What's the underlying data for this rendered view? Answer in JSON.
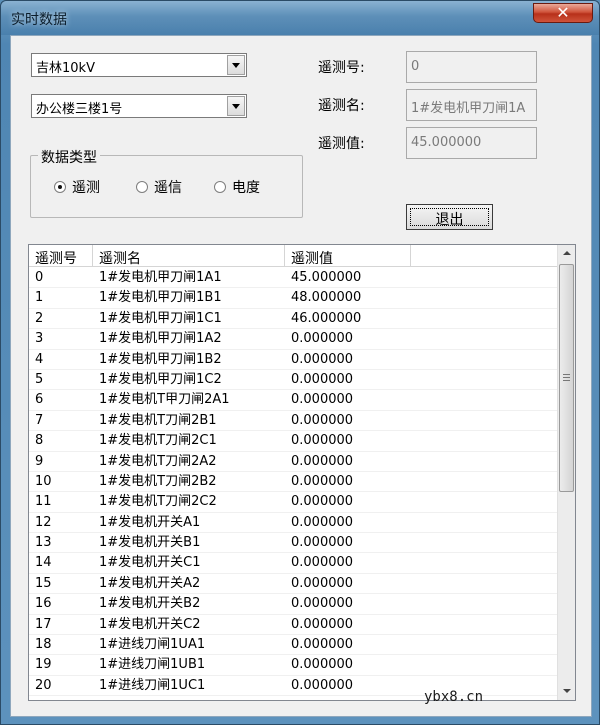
{
  "window": {
    "title": "实时数据",
    "close": "✕"
  },
  "combos": {
    "station": "吉林10kV",
    "building": "办公楼三楼1号"
  },
  "fields": {
    "id_label": "遥测号:",
    "id_value": "0",
    "name_label": "遥测名:",
    "name_value": "1#发电机甲刀闸1A",
    "value_label": "遥测值:",
    "value_value": "45.000000"
  },
  "datatype": {
    "title": "数据类型",
    "options": [
      "遥测",
      "遥信",
      "电度"
    ],
    "selected": "遥测"
  },
  "buttons": {
    "exit": "退出"
  },
  "list": {
    "columns": [
      "遥测号",
      "遥测名",
      "遥测值",
      ""
    ],
    "rows": [
      [
        "0",
        "1#发电机甲刀闸1A1",
        "45.000000"
      ],
      [
        "1",
        "1#发电机甲刀闸1B1",
        "48.000000"
      ],
      [
        "2",
        "1#发电机甲刀闸1C1",
        "46.000000"
      ],
      [
        "3",
        "1#发电机甲刀闸1A2",
        "0.000000"
      ],
      [
        "4",
        "1#发电机甲刀闸1B2",
        "0.000000"
      ],
      [
        "5",
        "1#发电机甲刀闸1C2",
        "0.000000"
      ],
      [
        "6",
        "1#发电机T甲刀闸2A1",
        "0.000000"
      ],
      [
        "7",
        "1#发电机T刀闸2B1",
        "0.000000"
      ],
      [
        "8",
        "1#发电机T刀闸2C1",
        "0.000000"
      ],
      [
        "9",
        "1#发电机T刀闸2A2",
        "0.000000"
      ],
      [
        "10",
        "1#发电机T刀闸2B2",
        "0.000000"
      ],
      [
        "11",
        "1#发电机T刀闸2C2",
        "0.000000"
      ],
      [
        "12",
        "1#发电机开关A1",
        "0.000000"
      ],
      [
        "13",
        "1#发电机开关B1",
        "0.000000"
      ],
      [
        "14",
        "1#发电机开关C1",
        "0.000000"
      ],
      [
        "15",
        "1#发电机开关A2",
        "0.000000"
      ],
      [
        "16",
        "1#发电机开关B2",
        "0.000000"
      ],
      [
        "17",
        "1#发电机开关C2",
        "0.000000"
      ],
      [
        "18",
        "1#进线刀闸1UA1",
        "0.000000"
      ],
      [
        "19",
        "1#进线刀闸1UB1",
        "0.000000"
      ],
      [
        "20",
        "1#进线刀闸1UC1",
        "0.000000"
      ]
    ]
  },
  "watermark": "ybx8.cn"
}
